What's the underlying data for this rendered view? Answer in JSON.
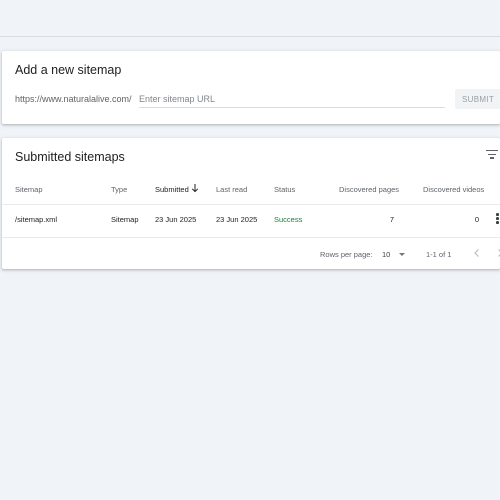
{
  "add_sitemap": {
    "title": "Add a new sitemap",
    "url_prefix": "https://www.naturalalive.com/",
    "input_value": "",
    "input_placeholder": "Enter sitemap URL",
    "submit_label": "SUBMIT"
  },
  "submitted": {
    "title": "Submitted sitemaps",
    "filter_icon": "filter-icon",
    "columns": [
      "Sitemap",
      "Type",
      "Submitted",
      "Last read",
      "Status",
      "Discovered pages",
      "Discovered videos"
    ],
    "sorted_column": "Submitted",
    "sort_direction": "descending",
    "rows": [
      {
        "sitemap": "/sitemap.xml",
        "type": "Sitemap",
        "submitted": "23 Jun 2025",
        "last_read": "23 Jun 2025",
        "status": "Success",
        "discovered_pages": "7",
        "discovered_videos": "0"
      }
    ],
    "pagination": {
      "rows_per_page_label": "Rows per page:",
      "rows_per_page_value": "10",
      "range": "1-1 of 1"
    }
  },
  "colors": {
    "background": "#f0f3f8",
    "status_success": "#188038",
    "text_primary": "#202124",
    "text_secondary": "#5f6368"
  }
}
